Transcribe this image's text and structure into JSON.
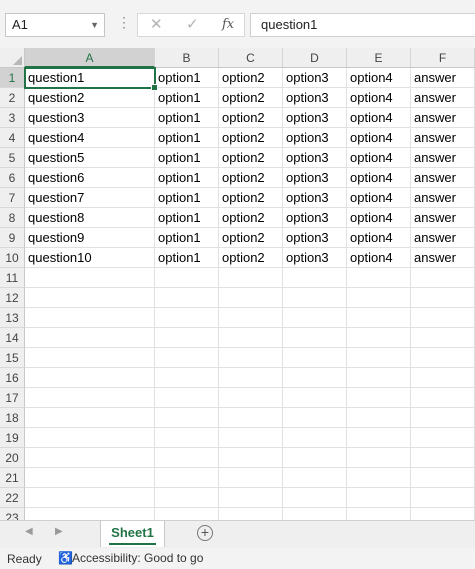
{
  "formula_bar": {
    "name_box": "A1",
    "cancel_icon": "✕",
    "enter_icon": "✓",
    "fx_label": "fx",
    "formula": "question1"
  },
  "columns": [
    "A",
    "B",
    "C",
    "D",
    "E",
    "F"
  ],
  "row_numbers": [
    "1",
    "2",
    "3",
    "4",
    "5",
    "6",
    "7",
    "8",
    "9",
    "10",
    "11",
    "12",
    "13",
    "14",
    "15",
    "16",
    "17",
    "18",
    "19",
    "20",
    "21",
    "22",
    "23"
  ],
  "rows": [
    [
      "question1",
      "option1",
      "option2",
      "option3",
      "option4",
      "answer"
    ],
    [
      "question2",
      "option1",
      "option2",
      "option3",
      "option4",
      "answer"
    ],
    [
      "question3",
      "option1",
      "option2",
      "option3",
      "option4",
      "answer"
    ],
    [
      "question4",
      "option1",
      "option2",
      "option3",
      "option4",
      "answer"
    ],
    [
      "question5",
      "option1",
      "option2",
      "option3",
      "option4",
      "answer"
    ],
    [
      "question6",
      "option1",
      "option2",
      "option3",
      "option4",
      "answer"
    ],
    [
      "question7",
      "option1",
      "option2",
      "option3",
      "option4",
      "answer"
    ],
    [
      "question8",
      "option1",
      "option2",
      "option3",
      "option4",
      "answer"
    ],
    [
      "question9",
      "option1",
      "option2",
      "option3",
      "option4",
      "answer"
    ],
    [
      "question10",
      "option1",
      "option2",
      "option3",
      "option4",
      "answer"
    ]
  ],
  "sheet_tabs": [
    "Sheet1"
  ],
  "status": {
    "ready": "Ready",
    "accessibility": "Accessibility: Good to go"
  },
  "colors": {
    "accent": "#217346"
  }
}
